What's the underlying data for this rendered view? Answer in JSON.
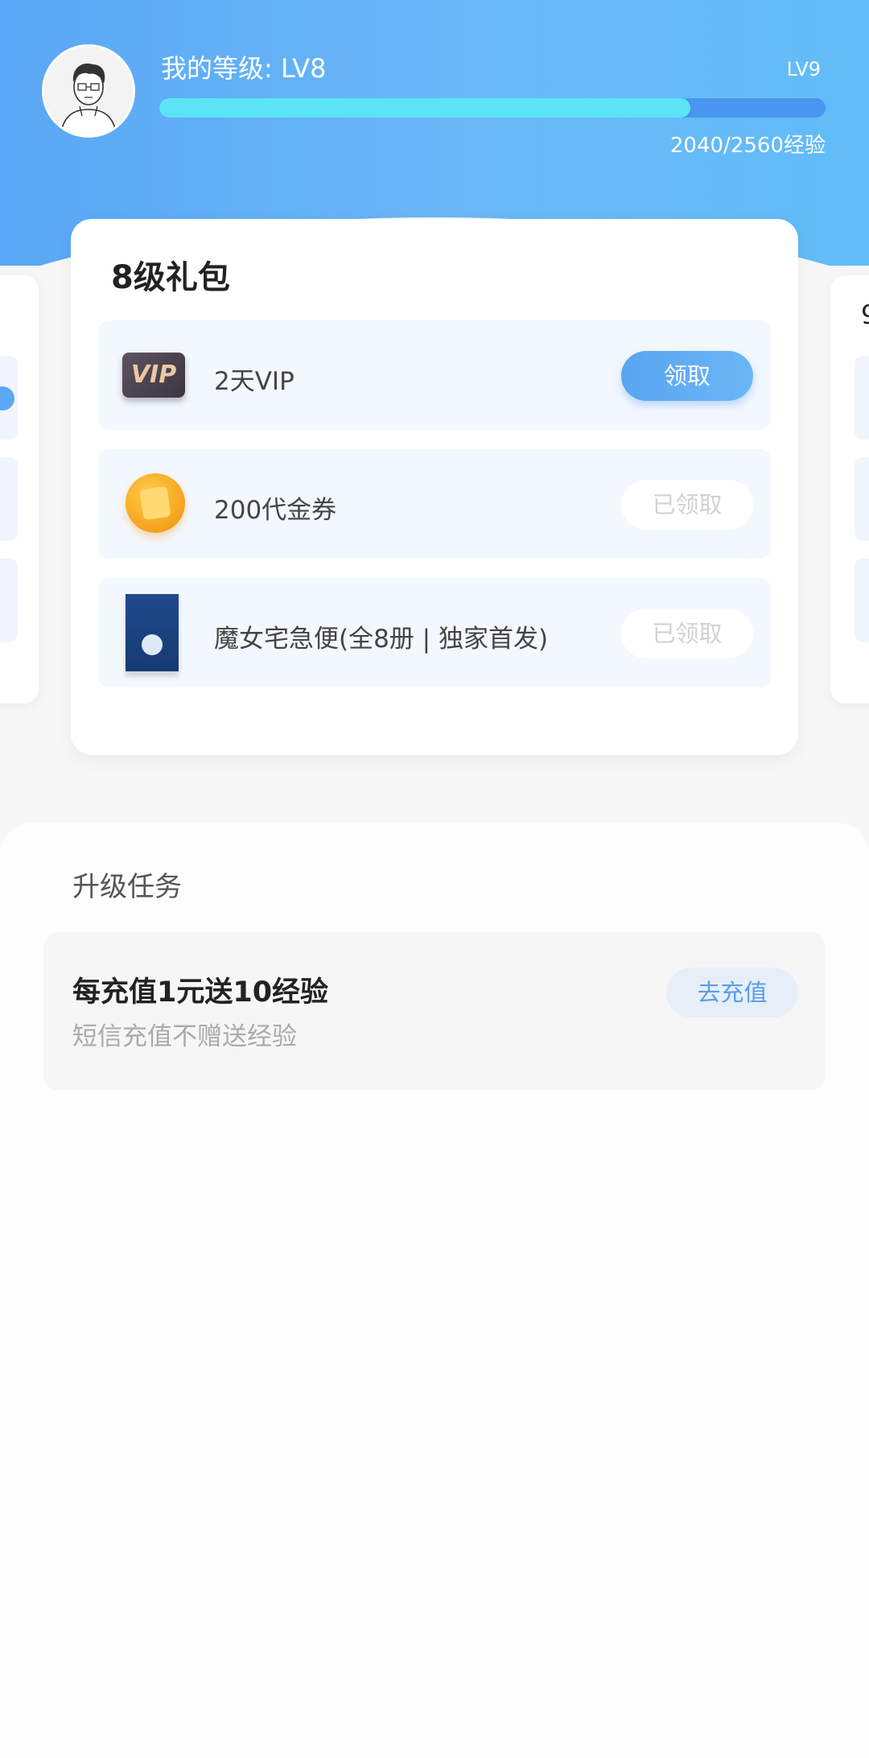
{
  "header": {
    "level_label": "我的等级: LV8",
    "next_level": "LV9",
    "progress_fraction": 0.7969,
    "exp_text": "2040/2560经验",
    "colors": {
      "track": "#4a95ef",
      "fill": "#5be3f6"
    }
  },
  "side_right": {
    "digit": "9"
  },
  "gift": {
    "title": "8级礼包",
    "items": [
      {
        "icon": "vip-badge-icon",
        "icon_text": "VIP",
        "name": "2天VIP",
        "button": "领取"
      },
      {
        "icon": "coin-icon",
        "name": "200代金券",
        "button": "已领取"
      },
      {
        "icon": "book-cover-icon",
        "name": "魔女宅急便(全8册 | 独家首发)",
        "button": "已领取"
      }
    ]
  },
  "tasks": {
    "heading": "升级任务",
    "items": [
      {
        "title": "每充值1元送10经验",
        "subtitle": "短信充值不赠送经验",
        "button": "去充值"
      }
    ]
  },
  "accent_color": "#5aa8f5"
}
